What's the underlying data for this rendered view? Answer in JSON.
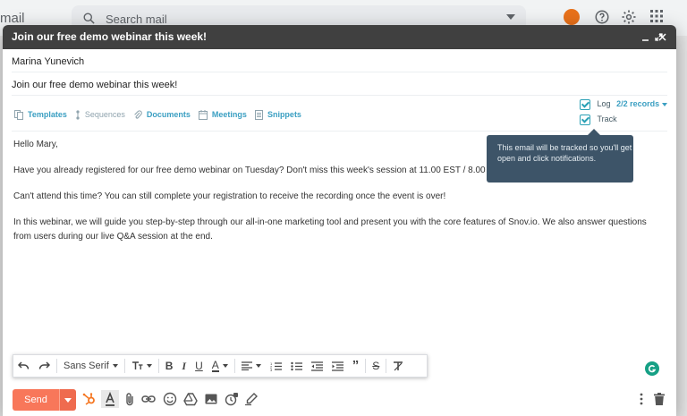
{
  "gmail": {
    "logo_text": "mail",
    "search_placeholder": "Search mail"
  },
  "compose": {
    "title": "Join our free demo webinar this week!",
    "controls": {
      "minimize": "_",
      "maximize": "⤢",
      "close": "✕"
    },
    "to": "Marina Yunevich",
    "subject": "Join our free demo webinar this week!"
  },
  "snov": {
    "templates": "Templates",
    "sequences": "Sequences",
    "documents": "Documents",
    "meetings": "Meetings",
    "snippets": "Snippets",
    "log_label": "Log",
    "records": "2/2 records",
    "track_label": "Track",
    "log_checked": true,
    "track_checked": true
  },
  "tooltip": {
    "text": "This email will be tracked so you'll get open and click notifications."
  },
  "body": {
    "greeting": "Hello Mary,",
    "p1": "Have you already registered for our free demo webinar on Tuesday? Don't miss this week's session at 11.00 EST / 8.00",
    "p2": "Can't attend this time? You can still complete your registration to receive the recording once the event is over!",
    "p3a": "In this webinar, we will guide you step-by-step through our all-in-one marketing tool and present you with the core features of Snov.io. We also answer questions",
    "p3b": "from users during our live Q&A session at the end."
  },
  "format_bar": {
    "font": "Sans Serif"
  },
  "bottom": {
    "send_label": "Send"
  },
  "colors": {
    "accent": "#3b9fc2",
    "send": "#f8775a",
    "header": "#404040",
    "tooltip": "#3d5468"
  }
}
